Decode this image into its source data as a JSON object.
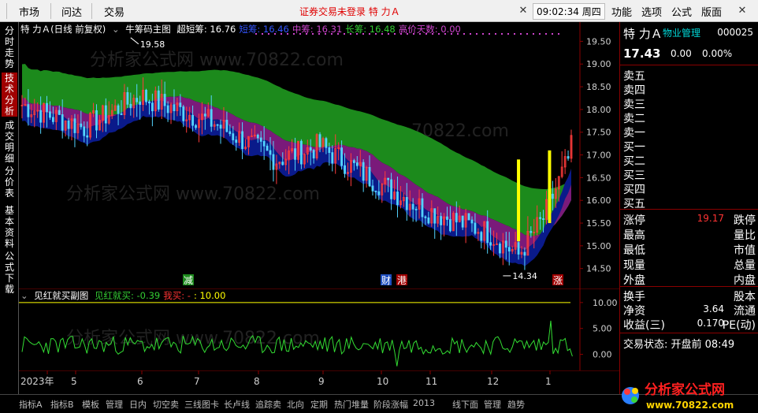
{
  "menu": {
    "items": [
      "市场",
      "问达",
      "交易"
    ],
    "login_status": "证券交易未登录  特 力Ａ",
    "right_items": [
      "功能",
      "选项",
      "公式",
      "版面"
    ],
    "clock": "09:02:34 周四"
  },
  "left_tabs": [
    {
      "label": "分时走势",
      "active": false
    },
    {
      "label": "技术分析",
      "active": true
    },
    {
      "label": "成交明细",
      "active": false
    },
    {
      "label": "分价表",
      "active": false
    },
    {
      "label": "基本资料",
      "active": false
    },
    {
      "label": "公式下载",
      "active": false
    }
  ],
  "main_indicator": {
    "title": "特 力Ａ(日线 前复权)",
    "formula": "牛筹码主图",
    "values": [
      {
        "label": "超短筹: 16.76",
        "color": "#ffffff"
      },
      {
        "label": "短筹: 16.46",
        "color": "#3355ff"
      },
      {
        "label": "中筹: 16.31",
        "color": "#cc44cc"
      },
      {
        "label": "长筹: 16.48",
        "color": "#33cc33"
      },
      {
        "label": "高价天数: 0.00",
        "color": "#cc44cc"
      }
    ]
  },
  "sub_indicator": {
    "title": "见红就买副图",
    "values": [
      {
        "label": "见红就买: -0.39",
        "color": "#33cc33"
      },
      {
        "label": "我买: -",
        "color": "#ff3333"
      },
      {
        "label": ": 10.00",
        "color": "#ffff00"
      }
    ]
  },
  "price_axis": [
    "19.50",
    "19.00",
    "18.50",
    "18.00",
    "17.50",
    "17.00",
    "16.50",
    "16.00",
    "15.50",
    "15.00",
    "14.50"
  ],
  "sub_axis": [
    "10.00",
    "5.00",
    "0.00"
  ],
  "x_axis": [
    "2023年",
    "5",
    "6",
    "7",
    "8",
    "9",
    "10",
    "11",
    "12",
    "1"
  ],
  "annotations": {
    "high": "19.58",
    "low": "14.34",
    "marks": [
      "减",
      "财",
      "港",
      "涨"
    ]
  },
  "quote": {
    "name": "特 力Ａ",
    "industry": "物业管理",
    "code": "000025",
    "price": "17.43",
    "change": "0.00",
    "pct": "0.00%",
    "order_book": [
      "卖五",
      "卖四",
      "卖三",
      "卖二",
      "卖一",
      "买一",
      "买二",
      "买三",
      "买四",
      "买五"
    ],
    "stats": [
      {
        "left": "涨停",
        "value": "19.17",
        "right": "跌停",
        "value_color": "#ff3333"
      },
      {
        "left": "最高",
        "value": "",
        "right": "量比",
        "value_color": "#ffffff"
      },
      {
        "left": "最低",
        "value": "",
        "right": "市值",
        "value_color": "#ffffff"
      },
      {
        "left": "现量",
        "value": "",
        "right": "总量",
        "value_color": "#ffffff"
      },
      {
        "left": "外盘",
        "value": "",
        "right": "内盘",
        "value_color": "#ffffff"
      }
    ],
    "fin": [
      {
        "left": "换手",
        "value": "",
        "right": "股本"
      },
      {
        "left": "净资",
        "value": "3.64",
        "right": "流通"
      },
      {
        "left": "收益(三)",
        "value": "0.170",
        "right": "PE(动)"
      }
    ],
    "trade_status": "交易状态: 开盘前 08:49"
  },
  "bottom_tabs": [
    "指标A",
    "指标B",
    "模板",
    "管理",
    "日内",
    "切空卖",
    "三线图卡",
    "长卢线",
    "追踪卖",
    "北向",
    "定期",
    "热门堆量",
    "阶段涨幅",
    "2013",
    "线下面",
    "管理",
    "趋势"
  ],
  "watermark": {
    "text": "分析家公式网",
    "url": "www.70822.com",
    "background_text": "分析家公式网 www.70822.com"
  },
  "chart_data": [
    {
      "type": "candlestick",
      "title": "特 力Ａ(日线 前复权)",
      "ylim": [
        14.2,
        19.75
      ],
      "price_range": {
        "high": 19.58,
        "low": 14.34,
        "last": 17.43
      },
      "x_labels": [
        "2023年",
        "5",
        "6",
        "7",
        "8",
        "9",
        "10",
        "11",
        "12",
        "1"
      ],
      "series": [
        {
          "name": "超短筹",
          "last": 16.76
        },
        {
          "name": "短筹",
          "last": 16.46
        },
        {
          "name": "中筹",
          "last": 16.31
        },
        {
          "name": "长筹",
          "last": 16.48
        },
        {
          "name": "高价天数",
          "last": 0.0
        }
      ]
    },
    {
      "type": "line",
      "title": "见红就买副图",
      "ylim": [
        -2.5,
        11.5
      ],
      "series": [
        {
          "name": "见红就买",
          "last": -0.39
        },
        {
          "name": "我买",
          "last": null
        },
        {
          "name": "",
          "values": [
            10.0
          ]
        }
      ]
    }
  ]
}
